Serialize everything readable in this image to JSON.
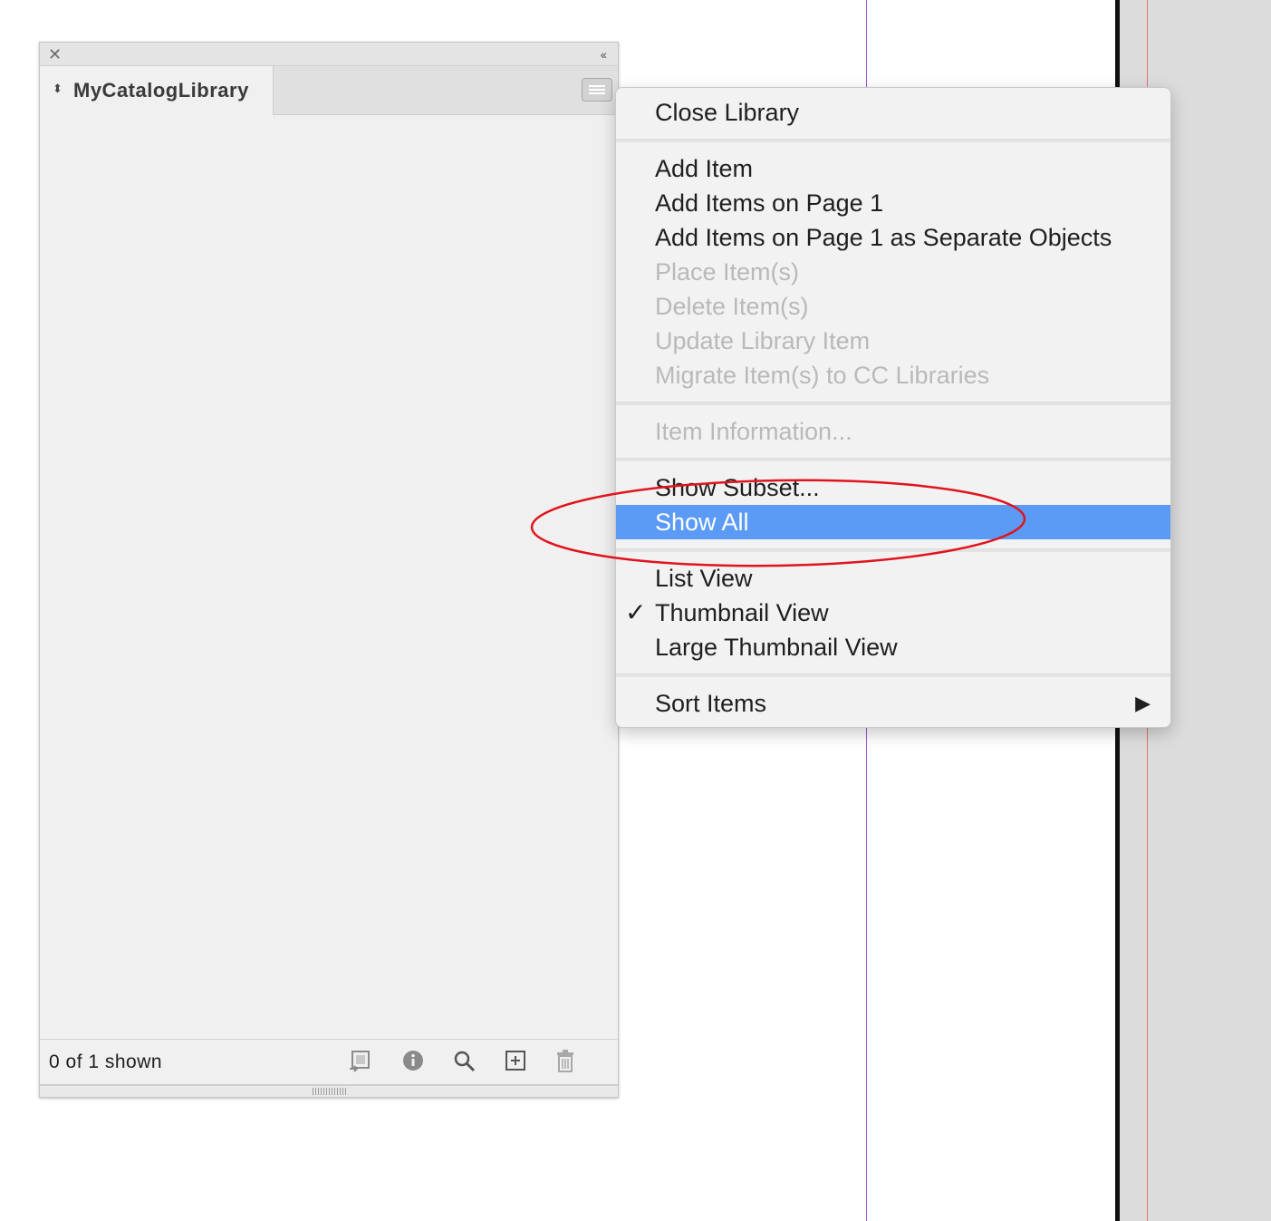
{
  "panel": {
    "close_glyph": "✕",
    "collapse_glyph": "‹‹",
    "tab_arrows_glyph": "⬍",
    "library_name": "MyCatalogLibrary",
    "status": "0 of 1 shown",
    "footer_icons": [
      "place-item-icon",
      "info-icon",
      "search-icon",
      "new-item-icon",
      "trash-icon"
    ]
  },
  "menu": {
    "close_library": "Close Library",
    "add_item": "Add Item",
    "add_items_on_page": "Add Items on Page 1",
    "add_items_separate": "Add Items on Page 1 as Separate Objects",
    "place_items": "Place Item(s)",
    "delete_items": "Delete Item(s)",
    "update_library_item": "Update Library Item",
    "migrate_items": "Migrate Item(s) to CC Libraries",
    "item_information": "Item Information...",
    "show_subset": "Show Subset...",
    "show_all": "Show All",
    "list_view": "List View",
    "thumbnail_view": "Thumbnail View",
    "large_thumbnail_view": "Large Thumbnail View",
    "sort_items": "Sort Items",
    "check_glyph": "✓",
    "submenu_glyph": "▶"
  },
  "colors": {
    "highlight": "#5b9bf5",
    "annotation": "#e0141e",
    "disabled_text": "#b9b9b9"
  }
}
